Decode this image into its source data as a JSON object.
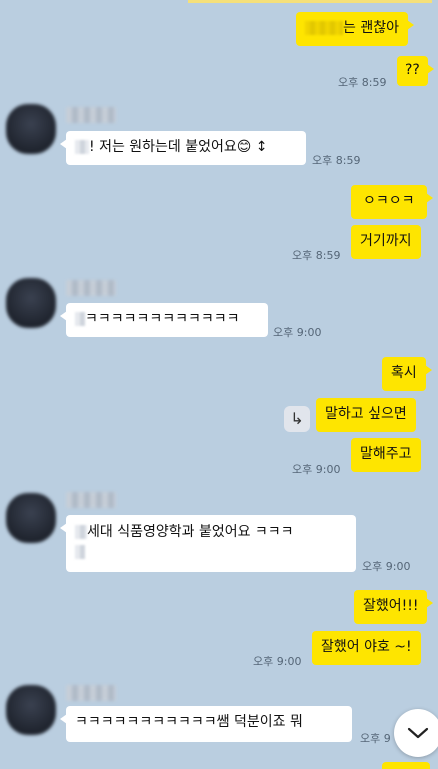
{
  "messages": {
    "m1": "는 괜찮아",
    "m2": "??",
    "t2": "오후 8:59",
    "m3": "! 저는 원하는데 붙었어요😊 ↕",
    "t3": "오후 8:59",
    "m4": "ㅇㅋㅇㅋ",
    "m5": "거기까지",
    "t5": "오후 8:59",
    "m6": "ㅋㅋㅋㅋㅋㅋㅋㅋㅋㅋㅋㅋ",
    "t6": "오후 9:00",
    "m7": "혹시",
    "m8": "말하고 싶으면",
    "m9": "말해주고",
    "t9": "오후 9:00",
    "m10a": "세대 식품영양학과 붙었어요 ㅋㅋㅋ",
    "t10": "오후 9:00",
    "m11": "잘했어!!!",
    "m12": "잘했어 야호 ~!",
    "t12": "오후 9:00",
    "m13": "ㅋㅋㅋㅋㅋㅋㅋㅋㅋㅋㅋ쌤 덕분이죠 뭐",
    "t13": "오후 9"
  },
  "icons": {
    "reply": "reply-arrow-icon",
    "scroll": "chevron-down-icon"
  },
  "colors": {
    "background": "#bacee0",
    "my_bubble": "#fee500",
    "their_bubble": "#ffffff"
  }
}
